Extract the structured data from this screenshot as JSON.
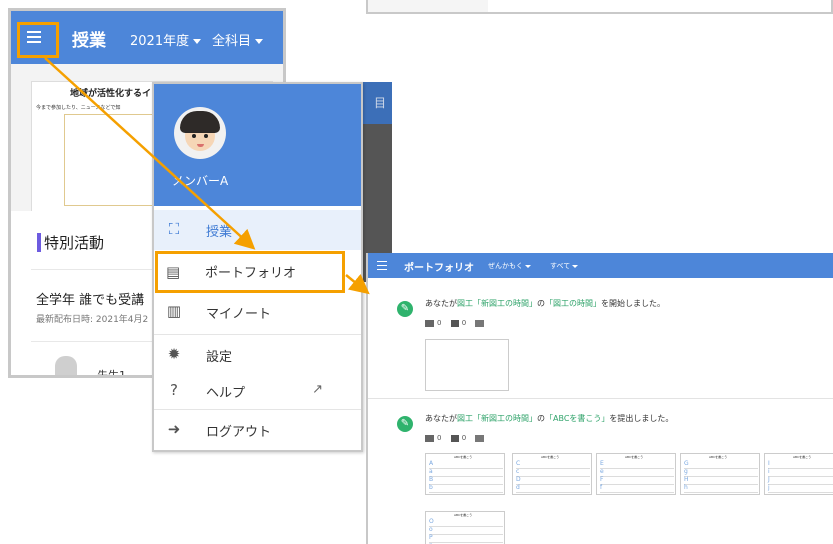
{
  "left_window": {
    "title": "授業",
    "year_dropdown": "2021年度",
    "subject_dropdown": "全科目",
    "card_heading": "地域が活性化するイ",
    "card_subtext": "今まで参加したり、ニュースなどで知",
    "section_title": "特別活動",
    "item_title": "全学年 誰でも受講",
    "distribution_date": "最新配布日時: 2021年4月2",
    "teacher": "先生1"
  },
  "drawer": {
    "dimmed_text": "目",
    "user_name": "メンバーA",
    "items": [
      {
        "label": "授業",
        "icon": "presentation-icon"
      },
      {
        "label": "ポートフォリオ",
        "icon": "portfolio-icon"
      },
      {
        "label": "マイノート",
        "icon": "notebook-icon"
      },
      {
        "label": "設定",
        "icon": "gear-icon"
      },
      {
        "label": "ヘルプ",
        "icon": "help-icon",
        "ext_icon": "external-link-icon"
      },
      {
        "label": "ログアウト",
        "icon": "logout-icon"
      }
    ]
  },
  "portfolio": {
    "title": "ポートフォリオ",
    "filter1": "ぜんかもく",
    "filter2": "すべて",
    "activities": [
      {
        "prefix": "あなたが",
        "subject": "図工「新図工の時間」",
        "mid": "の",
        "task": "「図工の時間」",
        "suffix": "を開始しました。",
        "comments": "0",
        "likes": "0"
      },
      {
        "prefix": "あなたが",
        "subject": "図工「新図工の時間」",
        "mid": "の",
        "task": "「ABCを書こう」",
        "suffix": "を提出しました。",
        "comments": "0",
        "likes": "0"
      }
    ],
    "sheet_title": "ABCを書こう",
    "sheets": [
      [
        "A",
        "a",
        "B",
        "b"
      ],
      [
        "C",
        "c",
        "D",
        "d"
      ],
      [
        "E",
        "e",
        "F",
        "f"
      ],
      [
        "G",
        "g",
        "H",
        "h"
      ],
      [
        "I",
        "i",
        "J",
        "j"
      ],
      [
        "O",
        "o",
        "P",
        "p"
      ]
    ]
  },
  "colors": {
    "app_blue": "#4d86d9",
    "highlight": "#f5a000",
    "accent_green": "#2fb36d"
  }
}
